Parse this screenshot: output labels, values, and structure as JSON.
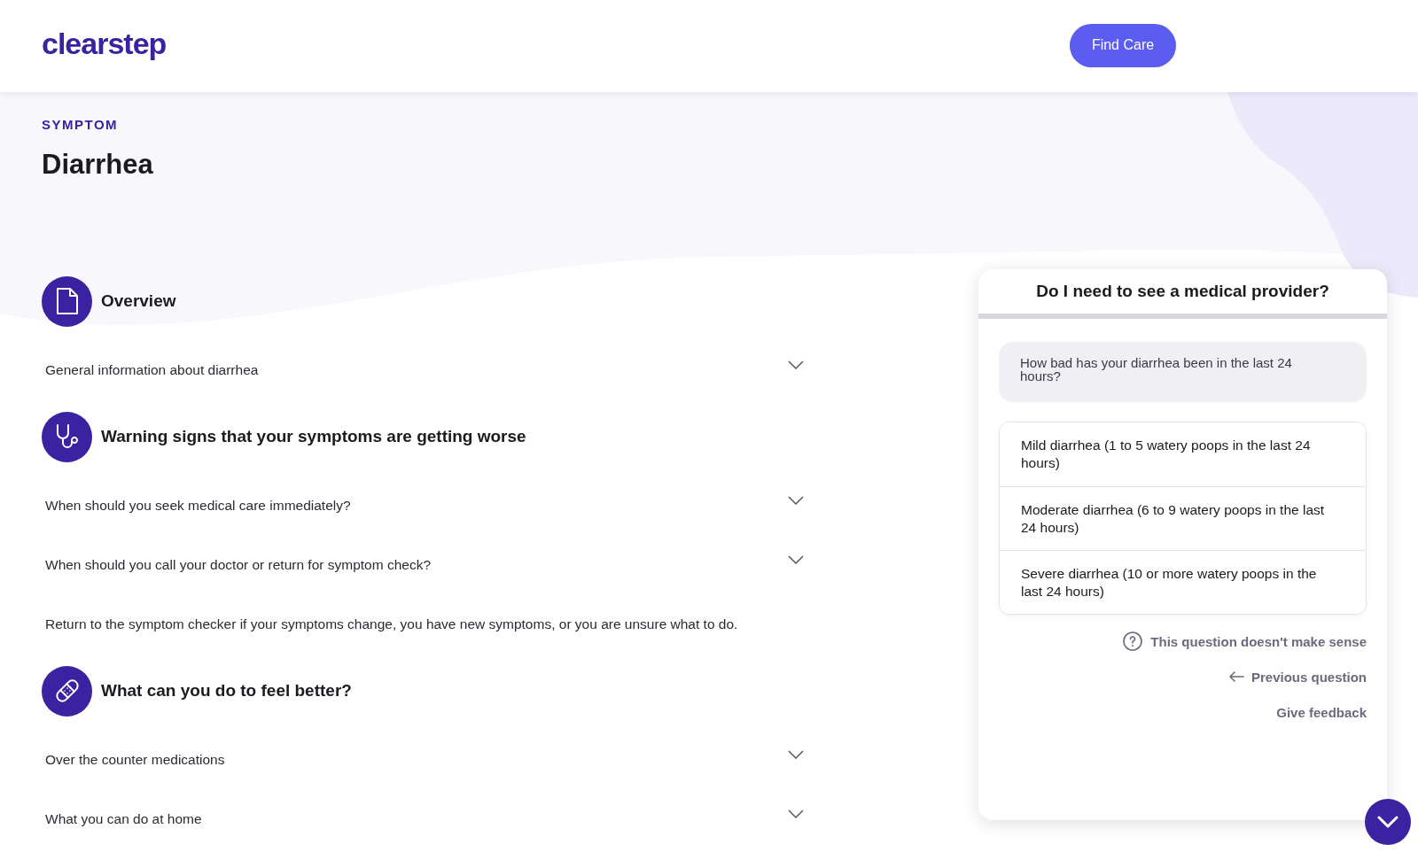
{
  "header": {
    "logo": "clearstep",
    "button": "Find Care"
  },
  "hero": {
    "eyebrow": "SYMPTOM",
    "title": "Diarrhea"
  },
  "sections": [
    {
      "heading": "Overview",
      "items": [
        {
          "kind": "accordion",
          "label": "General information about diarrhea",
          "expanded": false
        }
      ]
    },
    {
      "heading": "Warning signs that your symptoms are getting worse",
      "items": [
        {
          "kind": "accordion",
          "label": "When should you seek medical care immediately?",
          "expanded": false
        },
        {
          "kind": "accordion",
          "label": "When should you call your doctor or return for symptom check?",
          "expanded": false
        },
        {
          "kind": "text",
          "label": "Return to the symptom checker if your symptoms change, you have new symptoms, or you are unsure what to do."
        }
      ]
    },
    {
      "heading": "What can you do to feel better?",
      "items": [
        {
          "kind": "accordion",
          "label": "Over the counter medications",
          "expanded": false
        },
        {
          "kind": "accordion",
          "label": "What you can do at home",
          "expanded": false
        }
      ]
    }
  ],
  "panel": {
    "title": "Do I need to see a medical provider?",
    "question": "How bad has your diarrhea been in the last 24 hours?",
    "options": [
      "Mild diarrhea (1 to 5 watery poops in the last 24 hours)",
      "Moderate diarrhea (6 to 9 watery poops in the last 24 hours)",
      "Severe diarrhea (10 or more watery poops in the last 24 hours)"
    ],
    "links": [
      {
        "kind": "help",
        "label": "This question doesn't make sense"
      },
      {
        "kind": "back",
        "label": "Previous question"
      },
      {
        "kind": "plain",
        "label": "Give feedback"
      }
    ]
  }
}
